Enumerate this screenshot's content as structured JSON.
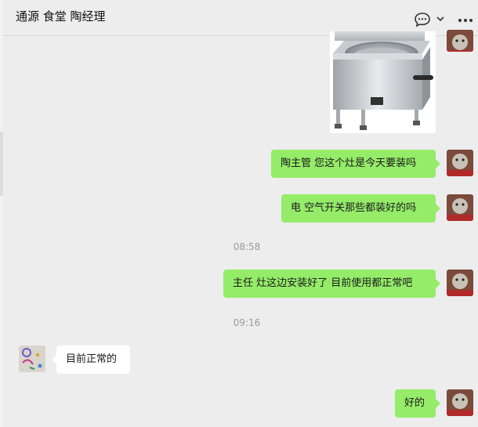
{
  "header": {
    "title": "通源 食堂 陶经理",
    "icons": [
      "chat-bubble-icon",
      "chevron-down-icon",
      "more-icon"
    ]
  },
  "messages": [
    {
      "side": "me",
      "type": "image",
      "description": "stove-image"
    },
    {
      "side": "me",
      "type": "text",
      "text": "陶主管 您这个灶是今天要装吗"
    },
    {
      "side": "me",
      "type": "text",
      "text": "电 空气开关那些都装好的吗"
    },
    {
      "type": "time",
      "text": "08:58"
    },
    {
      "side": "me",
      "type": "text",
      "text": "主任 灶这边安装好了 目前使用都正常吧"
    },
    {
      "type": "time",
      "text": "09:16"
    },
    {
      "side": "other",
      "type": "text",
      "text": "目前正常的"
    },
    {
      "side": "me",
      "type": "text",
      "text": "好的"
    }
  ],
  "colors": {
    "background": "#ededed",
    "my_bubble": "#95ec69",
    "other_bubble": "#ffffff",
    "timestamp": "#9b9b9b"
  }
}
